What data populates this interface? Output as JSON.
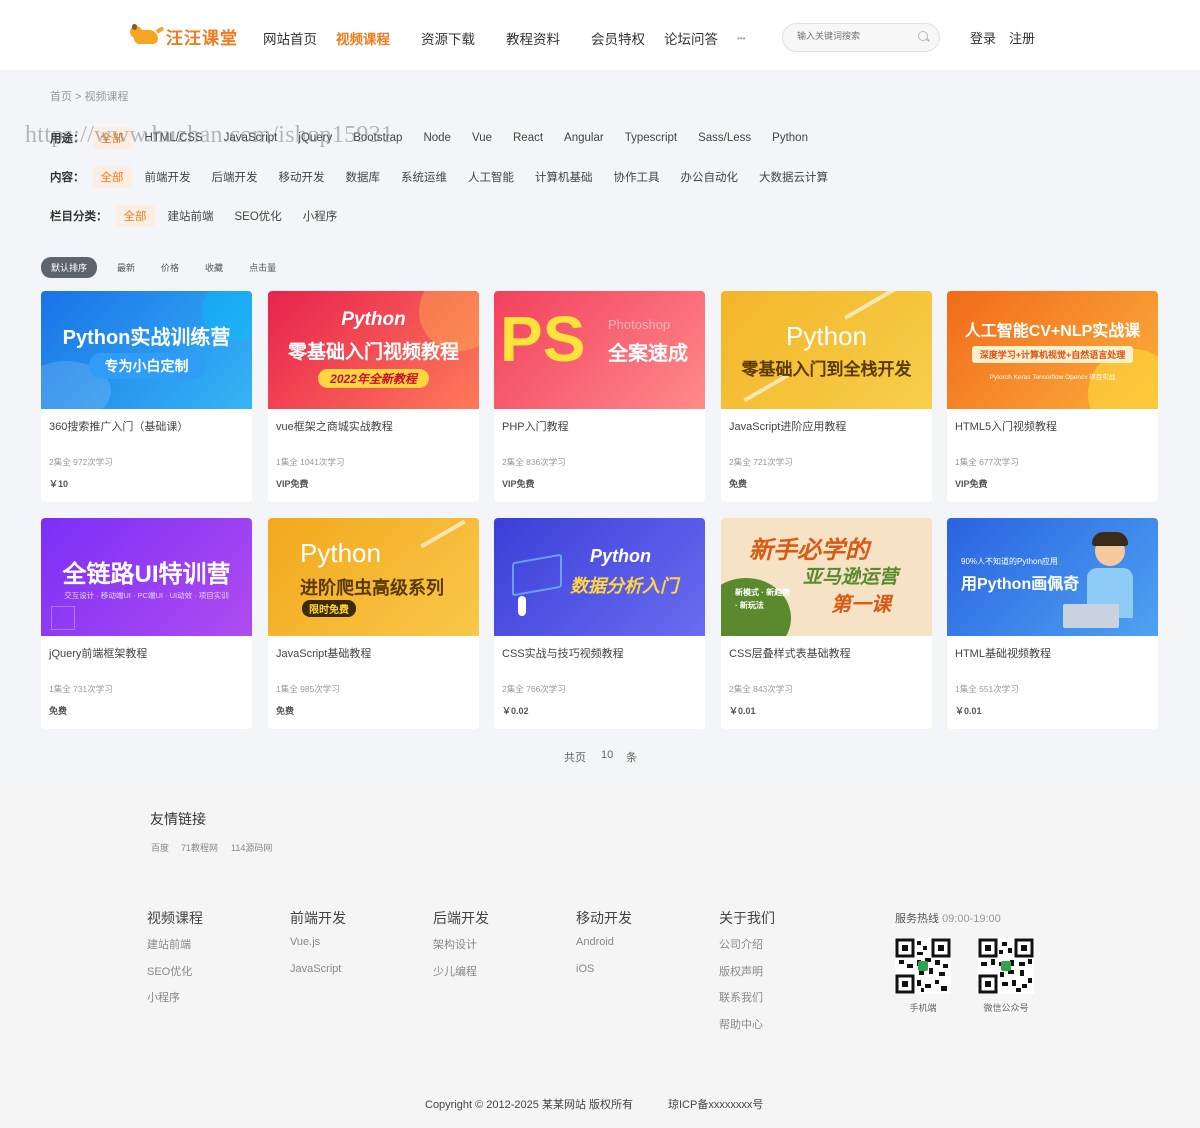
{
  "brand": {
    "name": "汪汪课堂"
  },
  "nav": {
    "items": [
      "网站首页",
      "视频课程",
      "资源下载",
      "教程资料",
      "会员特权",
      "论坛问答"
    ],
    "active_index": 1,
    "more": "•••"
  },
  "search": {
    "placeholder": "输入关键词搜索"
  },
  "auth": {
    "login": "登录",
    "register": "注册"
  },
  "breadcrumb": "首页 > 视频课程",
  "watermark": "https://www.huzhan.com/ishop15931",
  "filters": {
    "usage": {
      "label": "用途：",
      "options": [
        "全部",
        "HTML/CSS",
        "JavaScript",
        "jQuery",
        "Bootstrap",
        "Node",
        "Vue",
        "React",
        "Angular",
        "Typescript",
        "Sass/Less",
        "Python"
      ]
    },
    "content": {
      "label": "内容：",
      "options": [
        "全部",
        "前端开发",
        "后端开发",
        "移动开发",
        "数据库",
        "系统运维",
        "人工智能",
        "计算机基础",
        "协作工具",
        "办公自动化",
        "大数据云计算"
      ]
    },
    "column": {
      "label": "栏目分类：",
      "options": [
        "全部",
        "建站前端",
        "SEO优化",
        "小程序"
      ]
    }
  },
  "sort": [
    "默认排序",
    "最新",
    "价格",
    "收藏",
    "点击量"
  ],
  "courses": [
    {
      "title": "360搜索推广入门（基础课）",
      "meta": "2集全 972次学习",
      "price": "￥10",
      "thumb": {
        "main": "Python实战训练营",
        "sub": "专为小白定制",
        "bg": "#1a73e8",
        "bg2": "#35b6f5"
      }
    },
    {
      "title": "vue框架之商城实战教程",
      "meta": "1集全 1041次学习",
      "price": "VIP免费",
      "thumb": {
        "top": "Python",
        "main": "零基础入门视频教程",
        "sub": "2022年全新教程",
        "bg": "#e8224f",
        "bg2": "#ff7a59"
      }
    },
    {
      "title": "PHP入门教程",
      "meta": "2集全 836次学习",
      "price": "VIP免费",
      "thumb": {
        "big": "PS",
        "top": "Photoshop",
        "main": "全案速成",
        "bg": "#f2405e",
        "bg2": "#ff8a8a"
      }
    },
    {
      "title": "JavaScript进阶应用教程",
      "meta": "2集全 721次学习",
      "price": "免费",
      "thumb": {
        "top": "Python",
        "main": "零基础入门到全栈开发",
        "bg": "#f3b52a",
        "bg2": "#f7cf4a"
      }
    },
    {
      "title": "HTML5入门视频教程",
      "meta": "1集全 677次学习",
      "price": "VIP免费",
      "thumb": {
        "main": "人工智能CV+NLP实战课",
        "sub": "深度学习+计算机视觉+自然语言处理",
        "tags": "Pytorch  Keras  Tensorflow  Opencv  项目实战",
        "bg": "#f26a1b",
        "bg2": "#fbb03b"
      }
    },
    {
      "title": "jQuery前端框架教程",
      "meta": "1集全 731次学习",
      "price": "免费",
      "thumb": {
        "main": "全链路UI特训营",
        "sub": "交互设计 · 移动端UI · PC端UI · UI动效 · 项目实训",
        "bg": "#7b2ff7",
        "bg2": "#b04cf0"
      }
    },
    {
      "title": "JavaScript基础教程",
      "meta": "1集全 985次学习",
      "price": "免费",
      "thumb": {
        "top": "Python",
        "main": "进阶爬虫高级系列",
        "sub": "限时免费",
        "bg": "#f2a81d",
        "bg2": "#f9c84a"
      }
    },
    {
      "title": "CSS实战与技巧视频教程",
      "meta": "2集全 766次学习",
      "price": "￥0.02",
      "thumb": {
        "top": "Python",
        "main": "数据分析入门",
        "bg": "#3b3fd8",
        "bg2": "#6a6cf0"
      }
    },
    {
      "title": "CSS层叠样式表基础教程",
      "meta": "2集全 843次学习",
      "price": "￥0.01",
      "thumb": {
        "top": "新手必学的",
        "main": "亚马逊运营",
        "sub": "第一课",
        "list": "新模式 · 新趋势 · 新玩法",
        "bg": "#f6e3c6",
        "bg2": "#5b8a2e"
      }
    },
    {
      "title": "HTML基础视频教程",
      "meta": "1集全 551次学习",
      "price": "￥0.01",
      "thumb": {
        "top": "90%人不知道的Python应用",
        "main": "用Python画佩奇",
        "bg": "#2a62e0",
        "bg2": "#4ea3f2"
      }
    }
  ],
  "pagination": {
    "prefix": "共页",
    "count": "10",
    "suffix": "条"
  },
  "footer": {
    "links_title": "友情链接",
    "links": [
      "百度",
      "71教程网",
      "114源码网"
    ],
    "columns": [
      {
        "title": "视频课程",
        "items": [
          "建站前端",
          "SEO优化",
          "小程序"
        ]
      },
      {
        "title": "前端开发",
        "items": [
          "Vue.js",
          "JavaScript"
        ]
      },
      {
        "title": "后端开发",
        "items": [
          "架构设计",
          "少儿编程"
        ]
      },
      {
        "title": "移动开发",
        "items": [
          "Android",
          "iOS"
        ]
      },
      {
        "title": "关于我们",
        "items": [
          "公司介绍",
          "版权声明",
          "联系我们",
          "帮助中心"
        ]
      }
    ],
    "hotline_label": "服务热线",
    "hotline_hours": "09:00-19:00",
    "qr_captions": [
      "手机端",
      "微信公众号"
    ],
    "copyright": "Copyright © 2012-2025 某某网站 版权所有",
    "icp": "琼ICP备xxxxxxxx号"
  },
  "colors": {
    "accent": "#f07c1e",
    "page_bg": "#f3f5f8",
    "sort_active": "#5d6470"
  }
}
